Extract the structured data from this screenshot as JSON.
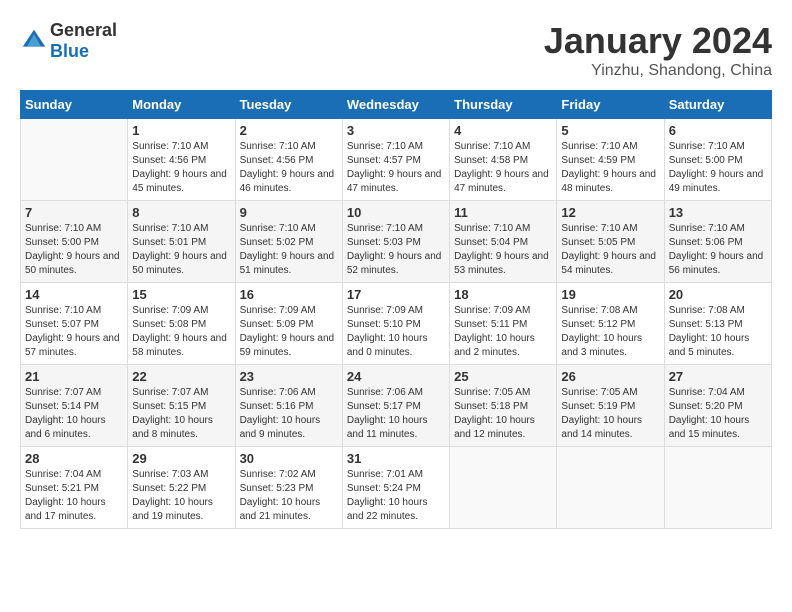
{
  "header": {
    "logo_general": "General",
    "logo_blue": "Blue",
    "month": "January 2024",
    "location": "Yinzhu, Shandong, China"
  },
  "weekdays": [
    "Sunday",
    "Monday",
    "Tuesday",
    "Wednesday",
    "Thursday",
    "Friday",
    "Saturday"
  ],
  "weeks": [
    [
      {
        "num": "",
        "sunrise": "",
        "sunset": "",
        "daylight": ""
      },
      {
        "num": "1",
        "sunrise": "Sunrise: 7:10 AM",
        "sunset": "Sunset: 4:56 PM",
        "daylight": "Daylight: 9 hours and 45 minutes."
      },
      {
        "num": "2",
        "sunrise": "Sunrise: 7:10 AM",
        "sunset": "Sunset: 4:56 PM",
        "daylight": "Daylight: 9 hours and 46 minutes."
      },
      {
        "num": "3",
        "sunrise": "Sunrise: 7:10 AM",
        "sunset": "Sunset: 4:57 PM",
        "daylight": "Daylight: 9 hours and 47 minutes."
      },
      {
        "num": "4",
        "sunrise": "Sunrise: 7:10 AM",
        "sunset": "Sunset: 4:58 PM",
        "daylight": "Daylight: 9 hours and 47 minutes."
      },
      {
        "num": "5",
        "sunrise": "Sunrise: 7:10 AM",
        "sunset": "Sunset: 4:59 PM",
        "daylight": "Daylight: 9 hours and 48 minutes."
      },
      {
        "num": "6",
        "sunrise": "Sunrise: 7:10 AM",
        "sunset": "Sunset: 5:00 PM",
        "daylight": "Daylight: 9 hours and 49 minutes."
      }
    ],
    [
      {
        "num": "7",
        "sunrise": "Sunrise: 7:10 AM",
        "sunset": "Sunset: 5:00 PM",
        "daylight": "Daylight: 9 hours and 50 minutes."
      },
      {
        "num": "8",
        "sunrise": "Sunrise: 7:10 AM",
        "sunset": "Sunset: 5:01 PM",
        "daylight": "Daylight: 9 hours and 50 minutes."
      },
      {
        "num": "9",
        "sunrise": "Sunrise: 7:10 AM",
        "sunset": "Sunset: 5:02 PM",
        "daylight": "Daylight: 9 hours and 51 minutes."
      },
      {
        "num": "10",
        "sunrise": "Sunrise: 7:10 AM",
        "sunset": "Sunset: 5:03 PM",
        "daylight": "Daylight: 9 hours and 52 minutes."
      },
      {
        "num": "11",
        "sunrise": "Sunrise: 7:10 AM",
        "sunset": "Sunset: 5:04 PM",
        "daylight": "Daylight: 9 hours and 53 minutes."
      },
      {
        "num": "12",
        "sunrise": "Sunrise: 7:10 AM",
        "sunset": "Sunset: 5:05 PM",
        "daylight": "Daylight: 9 hours and 54 minutes."
      },
      {
        "num": "13",
        "sunrise": "Sunrise: 7:10 AM",
        "sunset": "Sunset: 5:06 PM",
        "daylight": "Daylight: 9 hours and 56 minutes."
      }
    ],
    [
      {
        "num": "14",
        "sunrise": "Sunrise: 7:10 AM",
        "sunset": "Sunset: 5:07 PM",
        "daylight": "Daylight: 9 hours and 57 minutes."
      },
      {
        "num": "15",
        "sunrise": "Sunrise: 7:09 AM",
        "sunset": "Sunset: 5:08 PM",
        "daylight": "Daylight: 9 hours and 58 minutes."
      },
      {
        "num": "16",
        "sunrise": "Sunrise: 7:09 AM",
        "sunset": "Sunset: 5:09 PM",
        "daylight": "Daylight: 9 hours and 59 minutes."
      },
      {
        "num": "17",
        "sunrise": "Sunrise: 7:09 AM",
        "sunset": "Sunset: 5:10 PM",
        "daylight": "Daylight: 10 hours and 0 minutes."
      },
      {
        "num": "18",
        "sunrise": "Sunrise: 7:09 AM",
        "sunset": "Sunset: 5:11 PM",
        "daylight": "Daylight: 10 hours and 2 minutes."
      },
      {
        "num": "19",
        "sunrise": "Sunrise: 7:08 AM",
        "sunset": "Sunset: 5:12 PM",
        "daylight": "Daylight: 10 hours and 3 minutes."
      },
      {
        "num": "20",
        "sunrise": "Sunrise: 7:08 AM",
        "sunset": "Sunset: 5:13 PM",
        "daylight": "Daylight: 10 hours and 5 minutes."
      }
    ],
    [
      {
        "num": "21",
        "sunrise": "Sunrise: 7:07 AM",
        "sunset": "Sunset: 5:14 PM",
        "daylight": "Daylight: 10 hours and 6 minutes."
      },
      {
        "num": "22",
        "sunrise": "Sunrise: 7:07 AM",
        "sunset": "Sunset: 5:15 PM",
        "daylight": "Daylight: 10 hours and 8 minutes."
      },
      {
        "num": "23",
        "sunrise": "Sunrise: 7:06 AM",
        "sunset": "Sunset: 5:16 PM",
        "daylight": "Daylight: 10 hours and 9 minutes."
      },
      {
        "num": "24",
        "sunrise": "Sunrise: 7:06 AM",
        "sunset": "Sunset: 5:17 PM",
        "daylight": "Daylight: 10 hours and 11 minutes."
      },
      {
        "num": "25",
        "sunrise": "Sunrise: 7:05 AM",
        "sunset": "Sunset: 5:18 PM",
        "daylight": "Daylight: 10 hours and 12 minutes."
      },
      {
        "num": "26",
        "sunrise": "Sunrise: 7:05 AM",
        "sunset": "Sunset: 5:19 PM",
        "daylight": "Daylight: 10 hours and 14 minutes."
      },
      {
        "num": "27",
        "sunrise": "Sunrise: 7:04 AM",
        "sunset": "Sunset: 5:20 PM",
        "daylight": "Daylight: 10 hours and 15 minutes."
      }
    ],
    [
      {
        "num": "28",
        "sunrise": "Sunrise: 7:04 AM",
        "sunset": "Sunset: 5:21 PM",
        "daylight": "Daylight: 10 hours and 17 minutes."
      },
      {
        "num": "29",
        "sunrise": "Sunrise: 7:03 AM",
        "sunset": "Sunset: 5:22 PM",
        "daylight": "Daylight: 10 hours and 19 minutes."
      },
      {
        "num": "30",
        "sunrise": "Sunrise: 7:02 AM",
        "sunset": "Sunset: 5:23 PM",
        "daylight": "Daylight: 10 hours and 21 minutes."
      },
      {
        "num": "31",
        "sunrise": "Sunrise: 7:01 AM",
        "sunset": "Sunset: 5:24 PM",
        "daylight": "Daylight: 10 hours and 22 minutes."
      },
      {
        "num": "",
        "sunrise": "",
        "sunset": "",
        "daylight": ""
      },
      {
        "num": "",
        "sunrise": "",
        "sunset": "",
        "daylight": ""
      },
      {
        "num": "",
        "sunrise": "",
        "sunset": "",
        "daylight": ""
      }
    ]
  ]
}
